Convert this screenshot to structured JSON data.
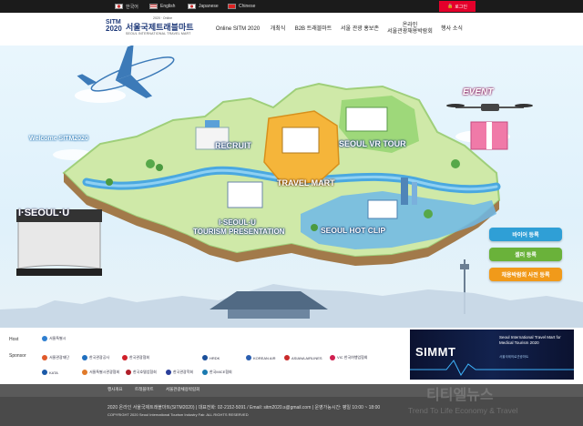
{
  "topbar": {
    "languages": [
      {
        "flag": "kr",
        "label": "한국어"
      },
      {
        "flag": "us",
        "label": "English"
      },
      {
        "flag": "jp",
        "label": "Japanese"
      },
      {
        "flag": "cn",
        "label": "Chinese"
      }
    ],
    "login_label": "로그인",
    "login_color": "#e4002b"
  },
  "header": {
    "logo": {
      "sitm": "SITM",
      "year": "2020",
      "online": "2020 · Online",
      "title": "서울국제트래블마트",
      "subtitle": "SEOUL INTERNATIONAL TRAVEL MART"
    },
    "nav": [
      "Online SITM 2020",
      "개최식",
      "B2B 트래블마트",
      "서울 관광 홍보존",
      "온라인\n서울관광채용박람회",
      "행사 소식"
    ]
  },
  "hero": {
    "welcome": "Welcome SITM2020",
    "event": "EVENT",
    "recruit": "RECRUIT",
    "seoul_vr_tour": "SEOUL VR TOUR",
    "travel_mart": "TRAVEL MART",
    "i_seoul_u": "I·SEOUL·U",
    "tourism_presentation_1": "I·SEOUL·U",
    "tourism_presentation_2": "TOURISM PRESENTATION",
    "seoul_hot_clip": "SEOUL HOT CLIP",
    "buttons": [
      {
        "label": "바이어 등록",
        "color": "#2f9fd6"
      },
      {
        "label": "셀러 등록",
        "color": "#6ab23a"
      },
      {
        "label": "채용박람회 사전 등록",
        "color": "#f19a1a"
      }
    ]
  },
  "sponsors": {
    "host_label": "Host",
    "host_logo": "서울특별시",
    "sponsor_label": "Sponsor",
    "row1": [
      "서울관광재단",
      "한국관광공사",
      "한국관광협회",
      "HRDK",
      "KOREAN AIR",
      "ASIANA AIRLINES",
      "VIC 한국여행업협회"
    ],
    "row2": [
      "KATA",
      "서울특별시관광협회",
      "한국호텔업협회",
      "한국관광학회",
      "한국MICE협회"
    ],
    "banner_title": "Seoul International Travel Mart for Medical Tourism 2020",
    "banner_logo": "SIMMT",
    "banner_sub": "서울국제의료관광마트"
  },
  "footer": {
    "links": [
      "행사개요",
      "트래블마트",
      "서울관광채용박람회"
    ],
    "line1": "2020 온라인 서울국제트래블마트(SITM2020)  |  대표전화: 02-2152-5091 / Email: sitm2020.s@gmail.com  |  운영가능시간: 평일 10:00 ~ 18:00",
    "line2": "COPYRIGHT 2020 Seoul International Tourism Industry Fair. ALL RIGHTS RESERVED",
    "watermark": "티티엘뉴스",
    "watermark2": "Trend To Life Economy & Travel"
  }
}
